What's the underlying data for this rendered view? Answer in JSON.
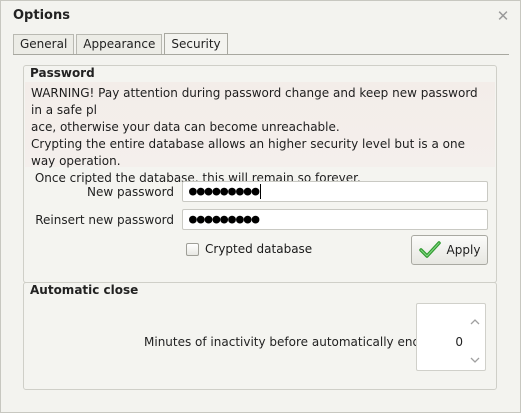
{
  "window": {
    "title": "Options"
  },
  "tabs": [
    {
      "label": "General"
    },
    {
      "label": "Appearance"
    },
    {
      "label": "Security"
    }
  ],
  "password_group": {
    "title": "Password",
    "warning_lines": [
      "WARNING! Pay attention during password change and keep new password in a safe pl",
      "ace, otherwise your data can become unreachable.",
      "Crypting the entire database allows an higher security level but is a one way operation.",
      " Once cripted the database, this will remain so forever."
    ],
    "new_password_label": "New password",
    "new_password_value": "●●●●●●●●●",
    "reinsert_password_label": "Reinsert new password",
    "reinsert_password_value": "●●●●●●●●●",
    "crypted_database_label": "Crypted database",
    "crypted_database_checked": false,
    "apply_label": "Apply"
  },
  "autoclose_group": {
    "title": "Automatic close",
    "minutes_label": "Minutes of inactivity before automatically ending",
    "minutes_value": "0"
  },
  "colors": {
    "accent_check": "#3aa63a",
    "warning_bg": "#f3ede9"
  },
  "icons": {
    "close": "close-icon",
    "apply": "checkmark-icon",
    "spin_up": "chevron-up-icon",
    "spin_down": "chevron-down-icon"
  }
}
